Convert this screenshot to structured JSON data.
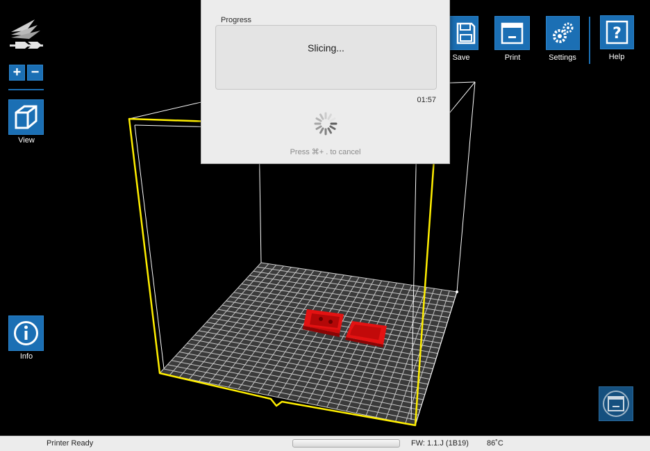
{
  "toolbar_left": {
    "zoom_in": "+",
    "zoom_out": "−",
    "view_label": "View",
    "info_label": "Info"
  },
  "toolbar_top": {
    "save_label": "Save",
    "print_label": "Print",
    "settings_label": "Settings",
    "help_label": "Help"
  },
  "progress_dialog": {
    "heading": "Progress",
    "status": "Slicing...",
    "elapsed": "01:57",
    "cancel_hint": "Press ⌘+ . to cancel"
  },
  "statusbar": {
    "status": "Printer Ready",
    "firmware": "FW: 1.1.J (1B19)",
    "temperature": "86˚C"
  },
  "colors": {
    "accent": "#1b6fb4",
    "selection": "#ffee00",
    "model": "#e01010",
    "background": "#000000"
  }
}
